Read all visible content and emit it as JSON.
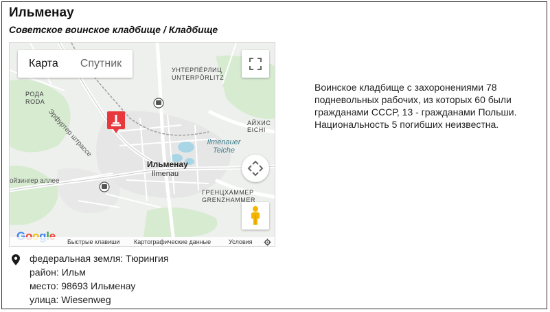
{
  "title": "Ильменау",
  "subtitle": "Советское воинское кладбище / Кладбище",
  "map": {
    "type_tabs": [
      {
        "label": "Карта",
        "active": true
      },
      {
        "label": "Спутник",
        "active": false
      }
    ],
    "labels": {
      "unterpoerlitz_ru": "УНТЕРПЁРЛИЦ",
      "unterpoerlitz_de": "UNTERPÖRLITZ",
      "roda_ru": "РОДА",
      "roda_de": "RODA",
      "road_erfurter": "Эрфуртер штрассе",
      "aichish_ru": "АЙХИС",
      "aichish_de": "EICHI",
      "lake": "Ilmenauer Teiche",
      "city_ru": "Ильменау",
      "city_de": "Ilmenau",
      "road_oizinger": "ойзингер аллее",
      "grenz_ru": "ГРЕНЦХАММЕР",
      "grenz_de": "GRENZHAMMER"
    },
    "attribution": {
      "logo": "Google",
      "shortcuts": "Быстрые клавиши",
      "map_data": "Картографические данные",
      "terms": "Условия"
    },
    "marker_color": "#e8383d"
  },
  "description": "Воинское кладбище с захоронениями 78 подневольных рабочих, из которых 60 были гражданами СССР, 13 - гражданами Польши. Национальность 5 погибших неизвестна.",
  "details": {
    "state": "федеральная земля: Тюрингия",
    "district": "район: Ильм",
    "place": "место: 98693 Ильменау",
    "street": "улица: Wiesenweg"
  }
}
